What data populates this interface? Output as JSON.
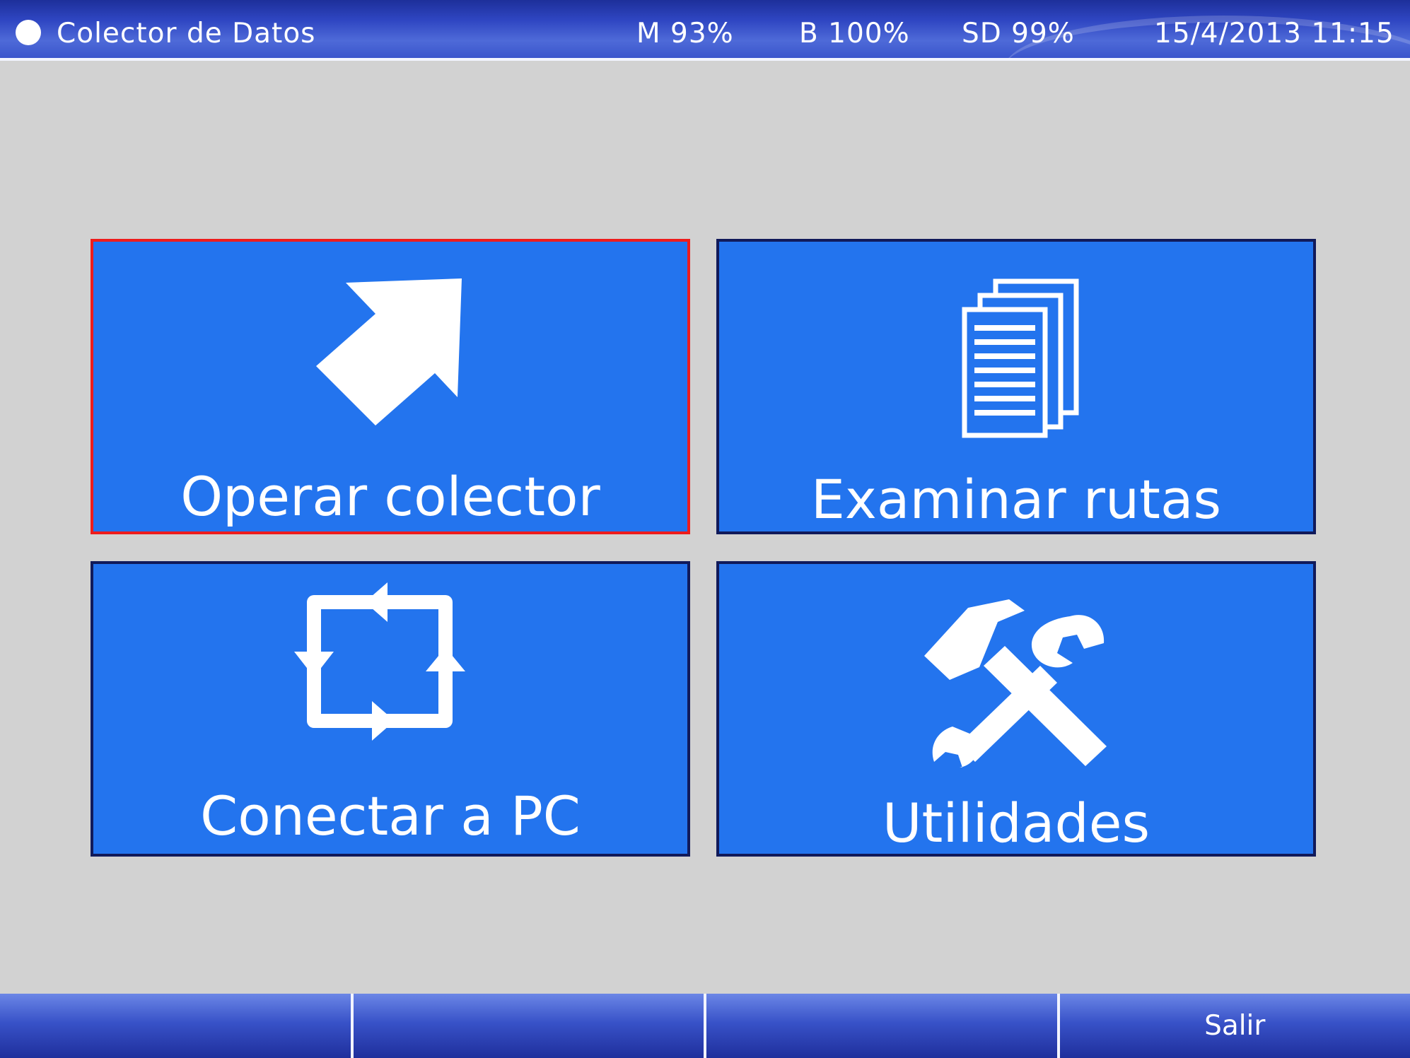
{
  "status_bar": {
    "title": "Colector de Datos",
    "memory": "M 93%",
    "battery": "B 100%",
    "sd_card": "SD 99%",
    "datetime": "15/4/2013 11:15",
    "indicator_icon": "circle-icon"
  },
  "menu": {
    "tiles": [
      {
        "label": "Operar colector",
        "icon": "arrow-up-right-icon",
        "selected": true
      },
      {
        "label": "Examinar rutas",
        "icon": "documents-icon",
        "selected": false
      },
      {
        "label": "Conectar a PC",
        "icon": "sync-arrows-icon",
        "selected": false
      },
      {
        "label": "Utilidades",
        "icon": "tools-icon",
        "selected": false
      }
    ]
  },
  "softkeys": [
    "",
    "",
    "",
    "Salir"
  ],
  "colors": {
    "background": "#d2d2d2",
    "tile": "#2374ee",
    "tile_border": "#111a5a",
    "selected_border": "#ee1c1c",
    "bar": "#2f46c2"
  }
}
